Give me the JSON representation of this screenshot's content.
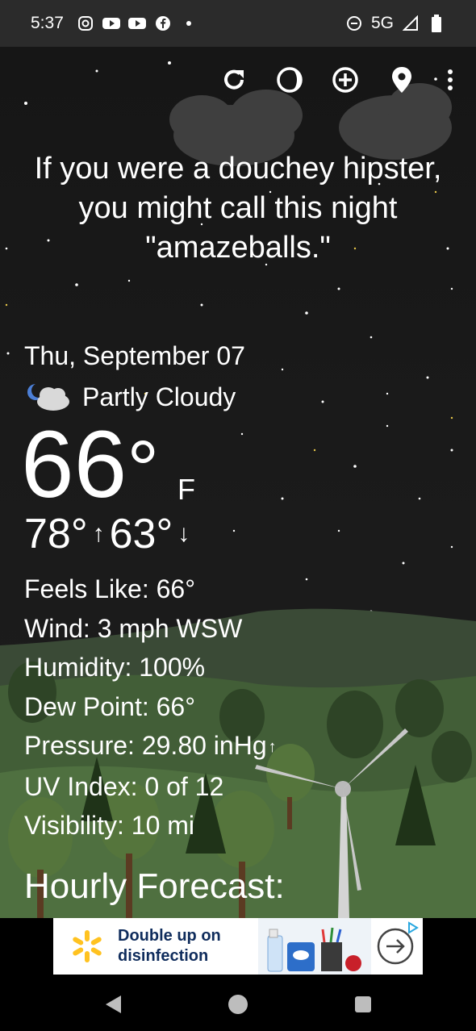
{
  "status_bar": {
    "time": "5:37",
    "left_icons": [
      "instagram-icon",
      "youtube-icon",
      "youtube-icon",
      "facebook-icon",
      "dot-icon"
    ],
    "network": "5G",
    "right_icons": [
      "do-not-disturb-icon",
      "signal-icon",
      "battery-icon"
    ]
  },
  "toolbar": {
    "buttons": [
      "refresh-icon",
      "moon-phase-icon",
      "add-location-icon",
      "location-pin-icon",
      "overflow-menu-icon"
    ]
  },
  "quip": "If you were a douchey hipster, you might call this night \"amazeballs.\"",
  "weather": {
    "date": "Thu, September 07",
    "condition": "Partly Cloudy",
    "condition_icon": "partly-cloudy-night-icon",
    "temperature": "66",
    "degree_symbol": "°",
    "unit": "F",
    "high": "78°",
    "high_arrow": "↑",
    "low": "63°",
    "low_arrow": "↓"
  },
  "details": {
    "feels_like": "Feels Like:  66°",
    "wind": "Wind:  3 mph WSW",
    "humidity": "Humidity:  100%",
    "dew_point": "Dew Point:  66°",
    "pressure": "Pressure:  29.80 inHg",
    "pressure_trend": "↑",
    "uv_index": "UV Index:  0 of 12",
    "visibility": "Visibility:  10 mi"
  },
  "hourly_title": "Hourly Forecast:",
  "ad": {
    "line1": "Double up on",
    "line2": "disinfection",
    "brand_color": "#ffc220",
    "arrow_icon": "arrow-right-circle-icon",
    "badge_icon": "adchoices-icon"
  },
  "nav_bar": {
    "buttons": [
      "back-icon",
      "home-icon",
      "recents-icon"
    ]
  },
  "colors": {
    "sky": "#1b1b1b",
    "hills": "#4a6b3c",
    "status_bar": "#2b2b2b"
  }
}
